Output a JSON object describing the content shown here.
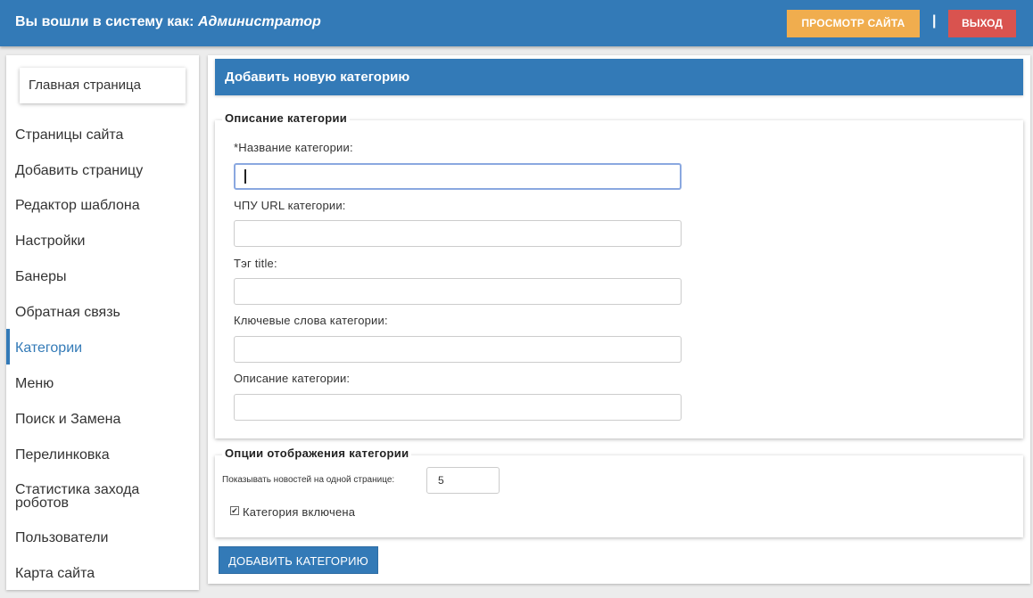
{
  "header": {
    "login_prefix": "Вы вошли в систему как:",
    "login_user": "Администратор",
    "view_site_label": "ПРОСМОТР САЙТА",
    "separator": "|",
    "logout_label": "ВЫХОД"
  },
  "sidebar": {
    "home_label": "Главная страница",
    "items": [
      {
        "label": "Страницы сайта"
      },
      {
        "label": "Добавить страницу"
      },
      {
        "label": "Редактор шаблона"
      },
      {
        "label": "Настройки"
      },
      {
        "label": "Банеры"
      },
      {
        "label": "Обратная связь"
      },
      {
        "label": "Категории",
        "active": true
      },
      {
        "label": "Меню"
      },
      {
        "label": "Поиск и Замена"
      },
      {
        "label": "Перелинковка"
      },
      {
        "label": "Статистика захода роботов"
      },
      {
        "label": "Пользователи"
      },
      {
        "label": "Карта сайта"
      }
    ]
  },
  "main": {
    "title": "Добавить новую категорию",
    "description_section": {
      "legend": "Описание категории",
      "fields": [
        {
          "label": "*Название категории:",
          "value": "",
          "focused": true
        },
        {
          "label": "ЧПУ URL категории:",
          "value": ""
        },
        {
          "label": "Тэг title:",
          "value": ""
        },
        {
          "label": "Ключевые слова категории:",
          "value": ""
        },
        {
          "label": "Описание категории:",
          "value": ""
        }
      ]
    },
    "options_section": {
      "legend": "Опции отображения категории",
      "news_per_page_label": "Показывать новостей на одной странице:",
      "news_per_page_value": "5",
      "enabled_label": "Категория включена",
      "enabled_checked": true
    },
    "submit_label": "ДОБАВИТЬ КАТЕГОРИЮ"
  },
  "colors": {
    "primary": "#337ab7",
    "warning": "#f0ad4e",
    "danger": "#d9534f"
  }
}
